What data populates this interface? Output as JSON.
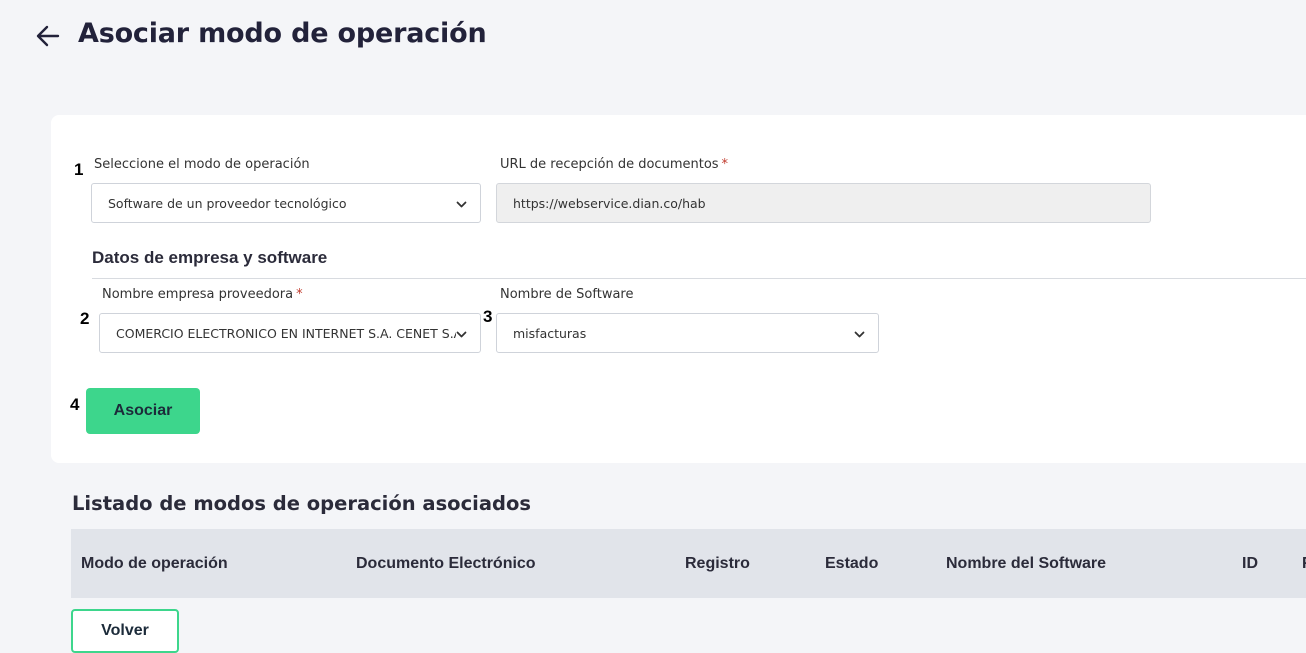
{
  "header": {
    "title": "Asociar modo de operación"
  },
  "form": {
    "steps": [
      "1",
      "2",
      "3",
      "4"
    ],
    "modo_operacion": {
      "label": "Seleccione el modo de operación",
      "value": "Software de un proveedor tecnológico"
    },
    "url_recepcion": {
      "label": "URL de recepción de documentos",
      "required_mark": "*",
      "value": "https://webservice.dian.co/hab"
    },
    "section_title": "Datos de empresa y software",
    "empresa_proveedora": {
      "label": "Nombre empresa proveedora",
      "required_mark": "*",
      "value": "COMERCIO ELECTRONICO EN INTERNET S.A. CENET S.A."
    },
    "nombre_software": {
      "label": "Nombre de Software",
      "value": "misfacturas"
    },
    "submit_label": "Asociar"
  },
  "listado": {
    "title": "Listado de modos de operación asociados",
    "columns": [
      "Modo de operación",
      "Documento Electrónico",
      "Registro",
      "Estado",
      "Nombre del Software",
      "ID",
      "F"
    ]
  },
  "footer": {
    "back_label": "Volver"
  },
  "colors": {
    "accent": "#3dd68c",
    "required": "#c0392b",
    "page_bg": "#f4f5f8",
    "table_header_bg": "#e1e4ea"
  },
  "icons": {
    "back": "arrow-left-icon",
    "dropdown": "chevron-down-icon"
  }
}
